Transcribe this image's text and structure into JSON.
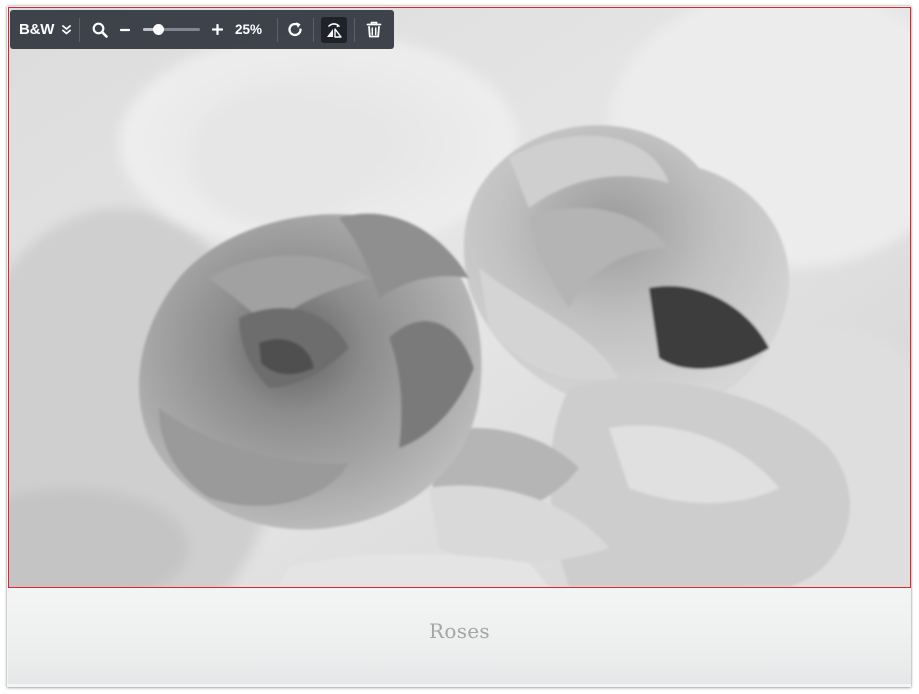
{
  "toolbar": {
    "filter_label": "B&W",
    "filter_menu_icon": "double-chevron-down-icon",
    "zoom_icon": "magnifier-icon",
    "zoom_out_icon": "minus-icon",
    "zoom_in_icon": "plus-icon",
    "zoom_level": 0.25,
    "zoom_label": "25%",
    "rotate_icon": "rotate-clockwise-icon",
    "flip_icon": "flip-horizontal-icon",
    "delete_icon": "trash-icon"
  },
  "photo": {
    "subject": "roses",
    "filter": "black-and-white"
  },
  "caption": "Roses",
  "colors": {
    "toolbar_bg": "#30343e",
    "frame_border": "#e2232c",
    "caption_text": "#a3a5a7"
  }
}
